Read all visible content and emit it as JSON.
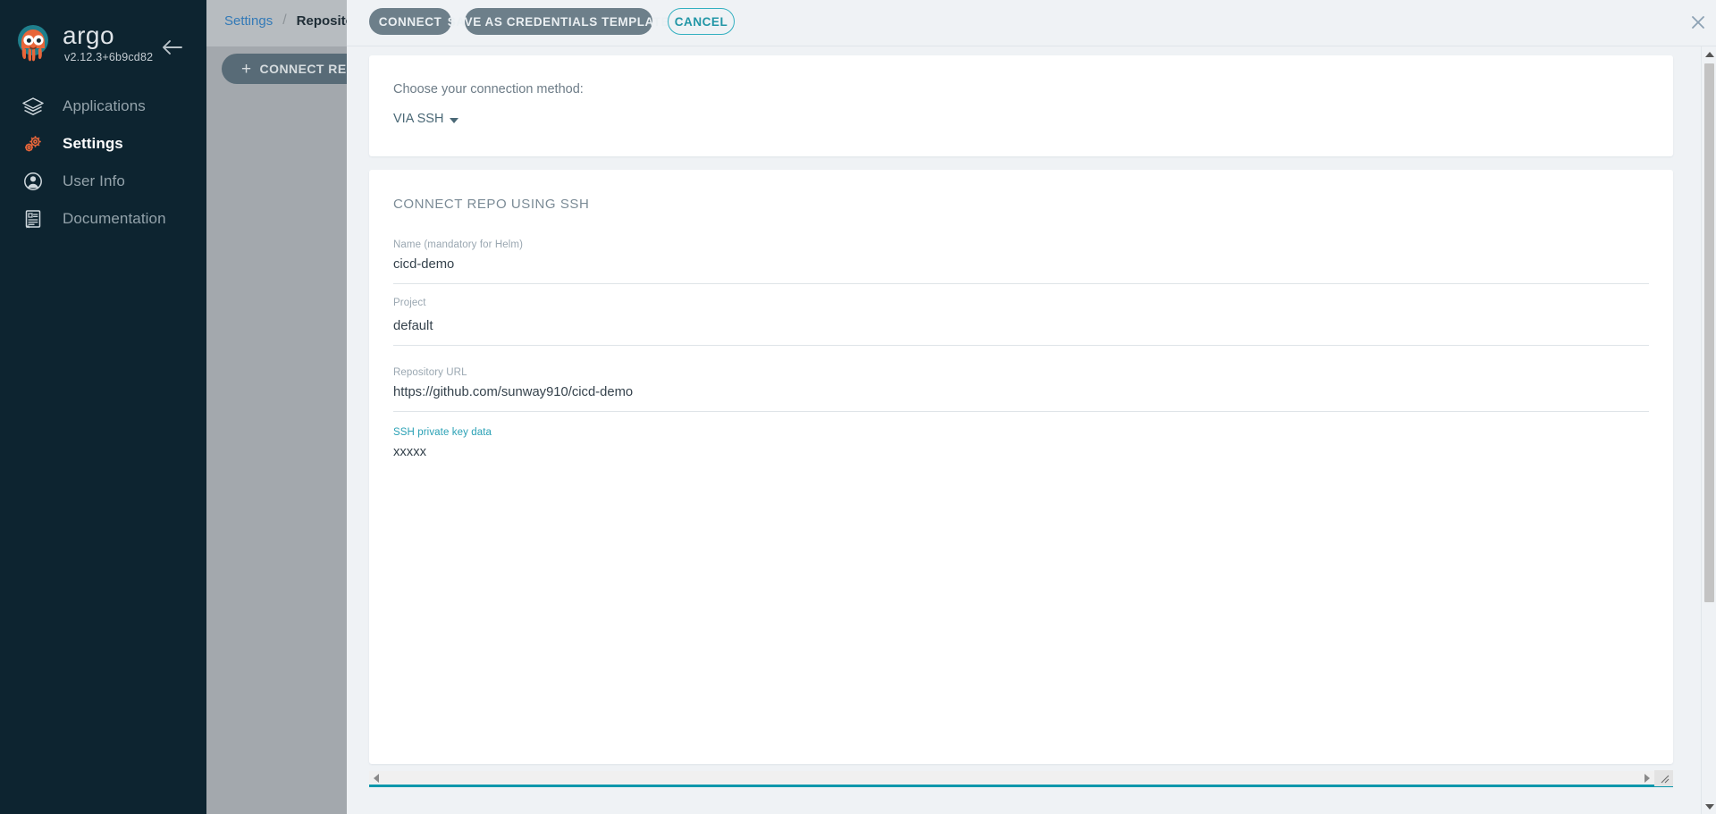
{
  "sidebar": {
    "brand": "argo",
    "version": "v2.12.3+6b9cd82",
    "collapse_icon": "arrow-left-icon",
    "items": [
      {
        "label": "Applications",
        "icon": "layers-icon",
        "active": false
      },
      {
        "label": "Settings",
        "icon": "gears-icon",
        "active": true
      },
      {
        "label": "User Info",
        "icon": "user-circle-icon",
        "active": false
      },
      {
        "label": "Documentation",
        "icon": "book-icon",
        "active": false
      }
    ]
  },
  "breadcrumb": {
    "root": "Settings",
    "separator": "/",
    "current": "Repositories"
  },
  "page": {
    "connect_repo_button": "CONNECT REPO",
    "plus_glyph": "+"
  },
  "modal": {
    "toolbar": {
      "connect_label": "CONNECT",
      "save_template_label": "SAVE AS CREDENTIALS TEMPLATE",
      "cancel_label": "CANCEL",
      "close_icon": "close-icon"
    },
    "method_card": {
      "prompt": "Choose your connection method:",
      "selected": "VIA SSH",
      "caret_icon": "chevron-down-icon"
    },
    "form": {
      "title": "CONNECT REPO USING SSH",
      "fields": [
        {
          "label": "Name (mandatory for Helm)",
          "value": "cicd-demo",
          "is_link_label": false
        },
        {
          "label": "Project",
          "value": "default",
          "is_link_label": false
        },
        {
          "label": "Repository URL",
          "value": "https://github.com/sunway910/cicd-demo",
          "is_link_label": false
        },
        {
          "label": "SSH private key data",
          "value": "xxxxx",
          "is_link_label": true
        }
      ]
    }
  },
  "scrollbars": {
    "horizontal": {
      "left_icon": "triangle-left-icon",
      "right_icon": "triangle-right-icon",
      "grip_icon": "resize-grip-icon"
    },
    "vertical": {
      "up_icon": "triangle-up-icon",
      "down_icon": "triangle-down-icon"
    }
  },
  "colors": {
    "sidebar_bg": "#0d2430",
    "accent_teal": "#2aa1b5",
    "button_slate": "#6d7f8a",
    "scrollbar_accent": "#0c97ab"
  }
}
